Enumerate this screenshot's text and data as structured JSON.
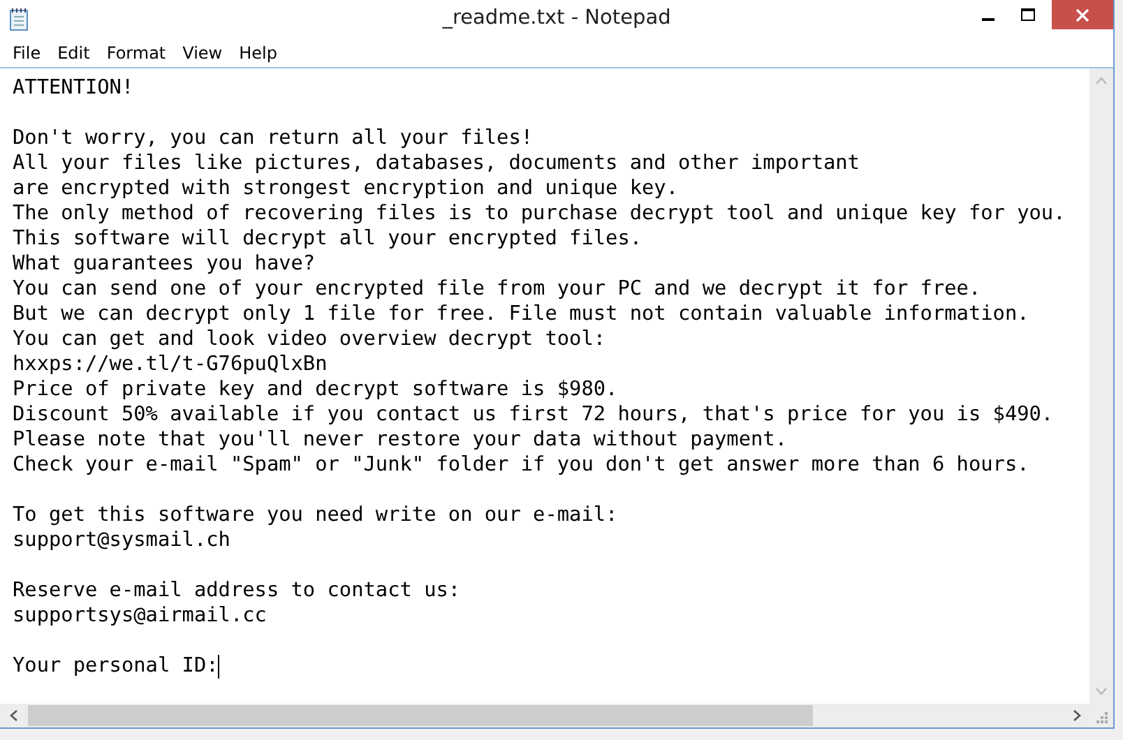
{
  "window": {
    "title": "_readme.txt - Notepad"
  },
  "menu": [
    "File",
    "Edit",
    "Format",
    "View",
    "Help"
  ],
  "document": {
    "cursor_visible": true,
    "paragraphs": [
      [
        "ATTENTION!"
      ],
      [
        "Don't worry, you can return all your files!",
        "All your files like pictures, databases, documents and other important",
        "are encrypted with strongest encryption and unique key.",
        "The only method of recovering files is to purchase decrypt tool and unique key for you.",
        "This software will decrypt all your encrypted files.",
        "What guarantees you have?",
        "You can send one of your encrypted file from your PC and we decrypt it for free.",
        "But we can decrypt only 1 file for free. File must not contain valuable information.",
        "You can get and look video overview decrypt tool:",
        "hxxps://we.tl/t-G76puQlxBn",
        "Price of private key and decrypt software is $980.",
        "Discount 50% available if you contact us first 72 hours, that's price for you is $490.",
        "Please note that you'll never restore your data without payment.",
        "Check your e-mail \"Spam\" or \"Junk\" folder if you don't get answer more than 6 hours."
      ],
      [
        "To get this software you need write on our e-mail:",
        "support@sysmail.ch"
      ],
      [
        "Reserve e-mail address to contact us:",
        "supportsys@airmail.cc"
      ],
      [
        "Your personal ID:"
      ]
    ]
  }
}
